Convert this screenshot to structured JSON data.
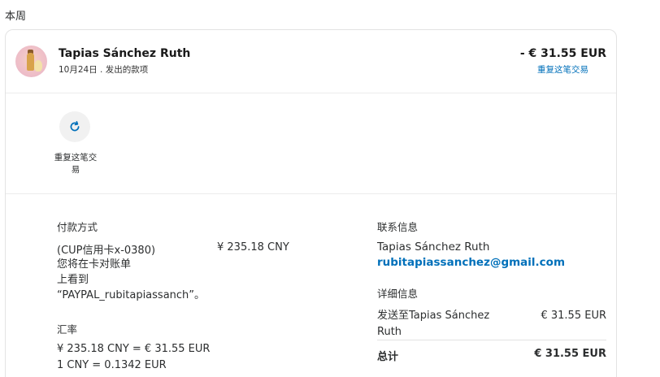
{
  "section_label": "本周",
  "transaction": {
    "merchant_name": "Tapias Sánchez Ruth",
    "meta": "10月24日 . 发出的款项",
    "amount": "- € 31.55 EUR",
    "repeat_link": "重复这笔交易"
  },
  "actions": {
    "repeat_button_icon": "refresh-icon",
    "repeat_label": "重复这笔交易"
  },
  "payment": {
    "title": "付款方式",
    "card": "(CUP信用卡x-0380)",
    "amount": "¥ 235.18 CNY",
    "note_lines": [
      "您将在卡对账单",
      "上看到",
      "“PAYPAL_rubitapiassanch”。"
    ]
  },
  "exchange": {
    "title": "汇率",
    "line1": "¥ 235.18 CNY = € 31.55 EUR",
    "line2": "1 CNY = 0.1342 EUR"
  },
  "contact": {
    "title": "联系信息",
    "name": "Tapias Sánchez Ruth",
    "email": "rubitapiassanchez@gmail.com"
  },
  "details": {
    "title": "详细信息",
    "sent_to_lines": [
      "发送至Tapias Sánchez",
      "Ruth"
    ],
    "sent_amount": "€ 31.55 EUR",
    "total_label": "总计",
    "total_amount": "€ 31.55 EUR"
  },
  "colors": {
    "link": "#0070ba",
    "text": "#2c2e2f",
    "border": "#e3e3e3"
  }
}
